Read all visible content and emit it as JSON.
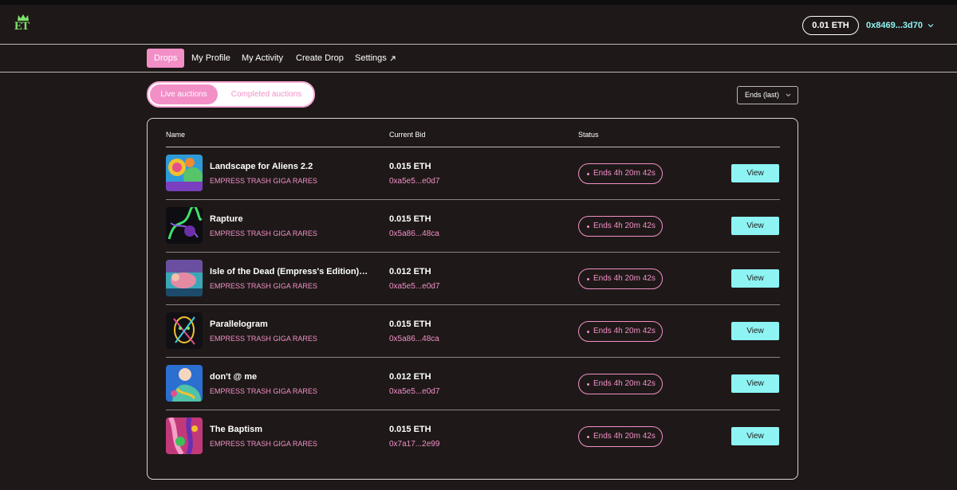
{
  "header": {
    "logo_text": "ET",
    "balance": "0.01 ETH",
    "wallet": "0x8469...3d70"
  },
  "nav": {
    "items": [
      {
        "label": "Drops",
        "active": true
      },
      {
        "label": "My Profile",
        "active": false
      },
      {
        "label": "My Activity",
        "active": false
      },
      {
        "label": "Create Drop",
        "active": false
      },
      {
        "label": "Settings",
        "active": false
      }
    ]
  },
  "tabs": {
    "live": "Live auctions",
    "completed": "Completed auctions"
  },
  "sort": {
    "selected": "Ends (last)"
  },
  "table": {
    "columns": {
      "name": "Name",
      "bid": "Current Bid",
      "status": "Status"
    },
    "rows": [
      {
        "title": "Landscape for Aliens 2.2",
        "collection": "EMPRESS TRASH GIGA RARES",
        "bid": "0.015 ETH",
        "bidder": "0xa5e5...e0d7",
        "status": "Ends 4h 20m 42s",
        "action": "View"
      },
      {
        "title": "Rapture",
        "collection": "EMPRESS TRASH GIGA RARES",
        "bid": "0.015 ETH",
        "bidder": "0x5a86...48ca",
        "status": "Ends 4h 20m 42s",
        "action": "View"
      },
      {
        "title": "Isle of the Dead (Empress's Edition) Fe...",
        "collection": "EMPRESS TRASH GIGA RARES",
        "bid": "0.012 ETH",
        "bidder": "0xa5e5...e0d7",
        "status": "Ends 4h 20m 42s",
        "action": "View"
      },
      {
        "title": "Parallelogram",
        "collection": "EMPRESS TRASH GIGA RARES",
        "bid": "0.015 ETH",
        "bidder": "0x5a86...48ca",
        "status": "Ends 4h 20m 42s",
        "action": "View"
      },
      {
        "title": "don't @ me",
        "collection": "EMPRESS TRASH GIGA RARES",
        "bid": "0.012 ETH",
        "bidder": "0xa5e5...e0d7",
        "status": "Ends 4h 20m 42s",
        "action": "View"
      },
      {
        "title": "The Baptism",
        "collection": "EMPRESS TRASH GIGA RARES",
        "bid": "0.015 ETH",
        "bidder": "0x7a17...2e99",
        "status": "Ends 4h 20m 42s",
        "action": "View"
      }
    ]
  },
  "colors": {
    "background": "#1e1918",
    "accent_pink": "#f28fc7",
    "accent_cyan": "#8ef3f3",
    "logo_green": "#7ee26a"
  }
}
